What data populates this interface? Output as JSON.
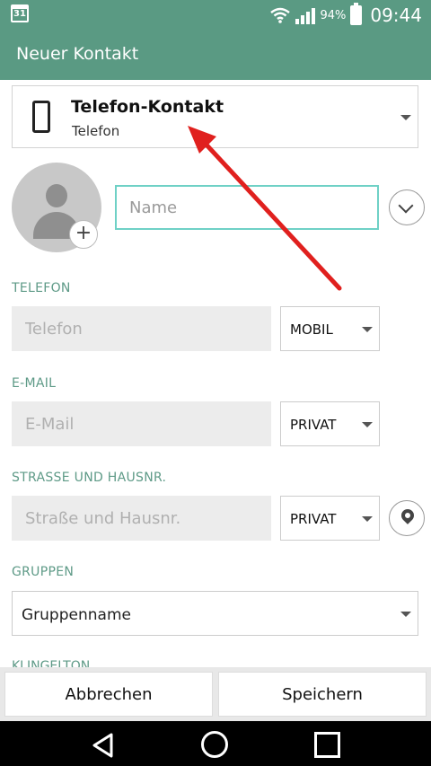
{
  "status_bar": {
    "calendar_day": "31",
    "battery": "94%",
    "time": "09:44"
  },
  "app_bar": {
    "title": "Neuer Kontakt"
  },
  "account": {
    "title": "Telefon-Kontakt",
    "subtitle": "Telefon"
  },
  "name": {
    "placeholder": "Name"
  },
  "phone": {
    "section_label": "TELEFON",
    "placeholder": "Telefon",
    "type": "MOBIL"
  },
  "email": {
    "section_label": "E-MAIL",
    "placeholder": "E-Mail",
    "type": "PRIVAT"
  },
  "address": {
    "section_label": "STRASSE UND HAUSNR.",
    "placeholder": "Straße und Hausnr.",
    "type": "PRIVAT"
  },
  "groups": {
    "section_label": "GRUPPEN",
    "value": "Gruppenname"
  },
  "ringtone": {
    "section_label": "KLINGELTON"
  },
  "buttons": {
    "cancel": "Abbrechen",
    "save": "Speichern"
  },
  "colors": {
    "app_bar": "#5a9a83",
    "section_label": "#5e9a87",
    "name_focus_border": "#6fd1c6",
    "annotation_arrow": "#e0201e"
  }
}
